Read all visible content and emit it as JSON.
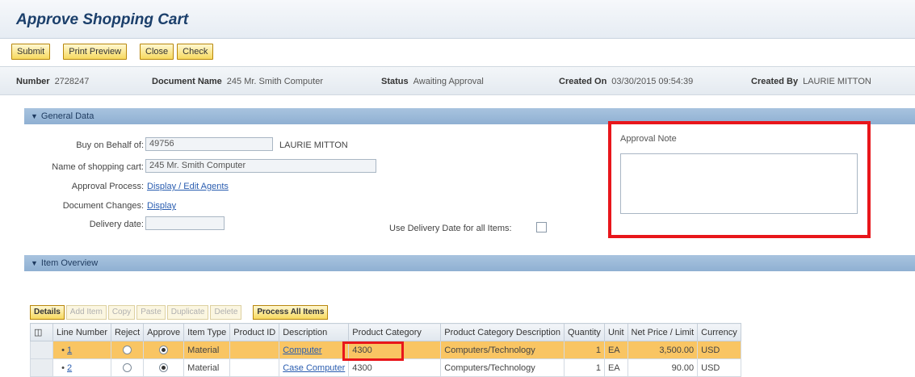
{
  "page": {
    "title": "Approve Shopping Cart"
  },
  "toolbar": {
    "submit": "Submit",
    "print_preview": "Print Preview",
    "close": "Close",
    "check": "Check"
  },
  "header": {
    "number_label": "Number",
    "number_value": "2728247",
    "docname_label": "Document Name",
    "docname_value": "245 Mr. Smith Computer",
    "status_label": "Status",
    "status_value": "Awaiting Approval",
    "created_on_label": "Created On",
    "created_on_value": "03/30/2015 09:54:39",
    "created_by_label": "Created By",
    "created_by_value": "LAURIE MITTON"
  },
  "general": {
    "section_title": "General Data",
    "buy_on_behalf_label": "Buy on Behalf of:",
    "buy_on_behalf_value": "49756",
    "buy_on_behalf_name": "LAURIE MITTON",
    "cart_name_label": "Name of shopping cart:",
    "cart_name_value": "245 Mr. Smith Computer",
    "approval_process_label": "Approval Process:",
    "approval_process_link": "Display / Edit Agents",
    "doc_changes_label": "Document Changes:",
    "doc_changes_link": "Display",
    "delivery_date_label": "Delivery date:",
    "delivery_date_value": "",
    "use_delivery_label": "Use Delivery Date for all Items:",
    "approval_note_label": "Approval Note",
    "approval_note_value": ""
  },
  "items": {
    "section_title": "Item Overview",
    "buttons": {
      "details": "Details",
      "add_item": "Add Item",
      "copy": "Copy",
      "paste": "Paste",
      "duplicate": "Duplicate",
      "delete": "Delete",
      "process_all": "Process All Items"
    },
    "columns": [
      "Line Number",
      "Reject",
      "Approve",
      "Item Type",
      "Product ID",
      "Description",
      "Product Category",
      "Product Category Description",
      "Quantity",
      "Unit",
      "Net Price / Limit",
      "Currency"
    ],
    "rows": [
      {
        "line": "1",
        "type": "Material",
        "product_id": "",
        "description": "Computer",
        "category": "4300",
        "category_desc": "Computers/Technology",
        "quantity": "1",
        "unit": "EA",
        "price": "3,500.00",
        "currency": "USD"
      },
      {
        "line": "2",
        "type": "Material",
        "product_id": "",
        "description": "Case Computer",
        "category": "4300",
        "category_desc": "Computers/Technology",
        "quantity": "1",
        "unit": "EA",
        "price": "90.00",
        "currency": "USD"
      }
    ]
  },
  "colors": {
    "highlight": "#e8161b",
    "section": "#9bb9d9",
    "selected_row": "#f9c563",
    "button": "#f7d95e"
  }
}
